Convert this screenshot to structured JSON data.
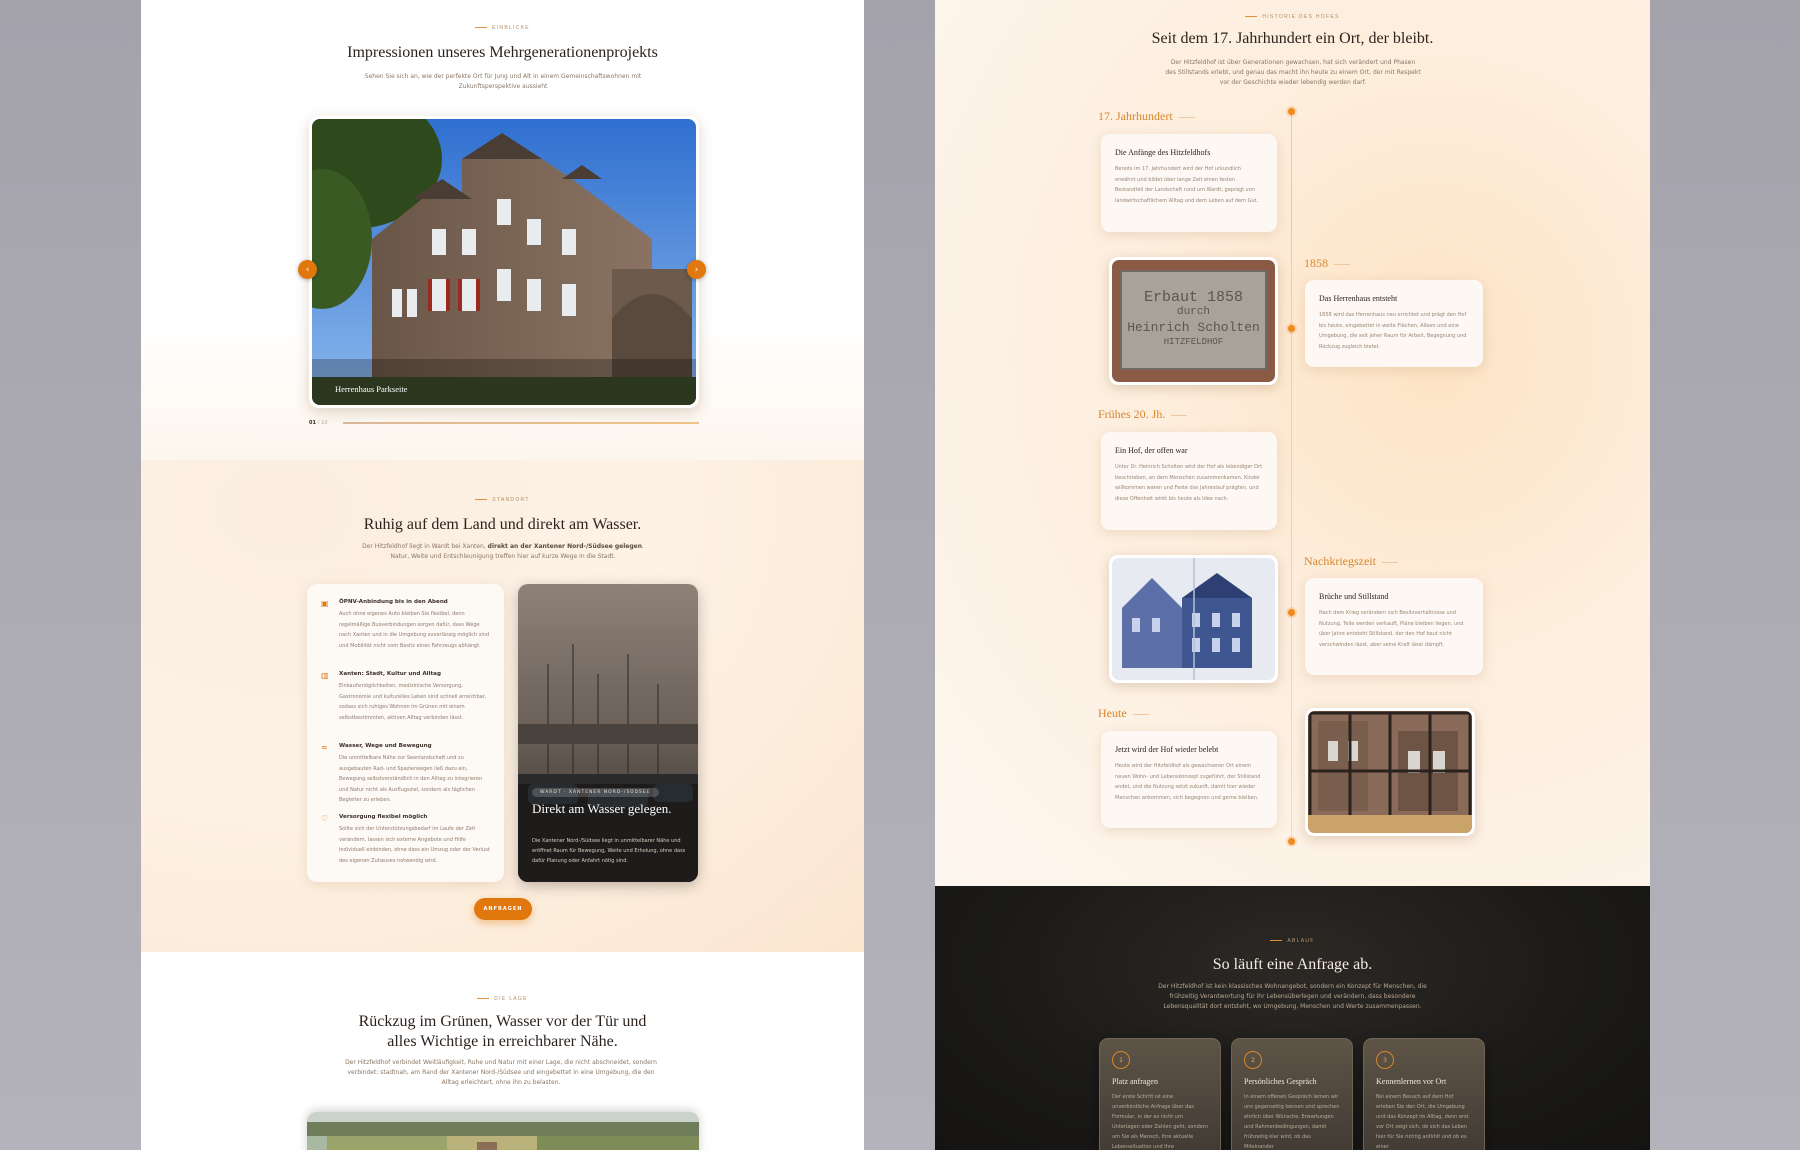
{
  "left": {
    "gallery": {
      "eyebrow": "EINBLICKE",
      "title": "Impressionen unseres Mehrgenerationenprojekts",
      "lead": "Sehen Sie sich an, wie der perfekte Ort für Jung und Alt in einem Gemeinschaftswohnen mit Zukunftsperspektive aussieht",
      "caption": "Herrenhaus Parkseite",
      "counter_current": "01",
      "counter_sep": "/",
      "counter_total": "10",
      "prev_icon": "‹",
      "next_icon": "›"
    },
    "location": {
      "eyebrow": "STANDORT",
      "title": "Ruhig auf dem Land und direkt am Wasser.",
      "lead_pre": "Der Hitzfeldhof liegt in Wardt bei Xanten, ",
      "lead_bold": "direkt an der Xantener Nord-/Südsee gelegen",
      "lead_post": ". Natur, Weite und Entschleunigung treffen hier auf kurze Wege in die Stadt.",
      "features": [
        {
          "icon": "bus-icon",
          "glyph": "▣",
          "title": "ÖPNV-Anbindung bis in den Abend",
          "text": "Auch ohne eigenes Auto bleiben Sie flexibel, denn regelmäßige Busverbindungen sorgen dafür, dass Wege nach Xanten und in die Umgebung zuverlässig möglich sind und Mobilität nicht vom Besitz eines Fahrzeugs abhängt."
        },
        {
          "icon": "city-icon",
          "glyph": "▥",
          "title": "Xanten: Stadt, Kultur und Alltag",
          "text": "Einkaufsmöglichkeiten, medizinische Versorgung, Gastronomie und kulturelles Leben sind schnell erreichbar, sodass sich ruhiges Wohnen im Grünen mit einem selbstbestimmten, aktiven Alltag verbinden lässt."
        },
        {
          "icon": "wave-icon",
          "glyph": "≈",
          "title": "Wasser, Wege und Bewegung",
          "text": "Die unmittelbare Nähe zur Seenlandschaft und zu ausgebauten Rad- und Spazierwegen ließ dazu ein, Bewegung selbstverständlich in den Alltag zu integrieren und Natur nicht als Ausflugsziel, sondern als täglichen Begleiter zu erleben."
        },
        {
          "icon": "heart-icon",
          "glyph": "♡",
          "title": "Versorgung flexibel möglich",
          "text": "Sollte sich der Unterstützungsbedarf im Laufe der Zeit verändern, lassen sich externe Angebote und Hilfe individuell einbinden, ohne dass ein Umzug oder der Verlust des eigenen Zuhauses notwendig wird."
        }
      ],
      "water_tag": "WARDT · XANTENER NORD-/SÜDSEE",
      "water_title": "Direkt am Wasser gelegen.",
      "water_text": "Die Xantener Nord-/Südsee liegt in unmittelbarer Nähe und eröffnet Raum für Bewegung, Weite und Erholung, ohne dass dafür Planung oder Anfahrt nötig sind.",
      "cta": "ANFRAGEN"
    },
    "lage": {
      "eyebrow": "DIE LAGE",
      "title_line1": "Rückzug im Grünen, Wasser vor der Tür und",
      "title_line2": "alles Wichtige in erreichbarer Nähe.",
      "lead": "Der Hitzfeldhof verbindet Weitläufigkeit, Ruhe und Natur mit einer Lage, die nicht abschneidet, sondern verbindet: stadtnah, am Rand der Xantener Nord-/Südsee und eingebettet in eine Umgebung, die den Alltag erleichtert, ohne ihn zu belasten."
    }
  },
  "right": {
    "history": {
      "eyebrow": "HISTORIE DES HOFES",
      "title": "Seit dem 17. Jahrhundert ein Ort, der bleibt.",
      "lead": "Der Hitzfeldhof ist über Generationen gewachsen, hat sich verändert und Phasen des Stillstands erlebt, und genau das macht ihn heute zu einem Ort, der mit Respekt vor der Geschichte wieder lebendig werden darf.",
      "entries": [
        {
          "era": "17. Jahrhundert",
          "title": "Die Anfänge des Hitzfeldhofs",
          "text": "Bereits im 17. Jahrhundert wird der Hof urkundlich erwähnt und bildet über lange Zeit einen festen Bestandteil der Landschaft rund um Wardt, geprägt von landwirtschaftlichem Alltag und dem Leben auf dem Gut."
        },
        {
          "era": "1858",
          "title": "Das Herrenhaus entsteht",
          "text": "1858 wird das Herrenhaus neu errichtet und prägt den Hof bis heute, eingebettet in weite Flächen, Alleen und eine Umgebung, die seit jeher Raum für Arbeit, Begegnung und Rückzug zugleich bietet.",
          "stone_line1": "Erbaut 1858",
          "stone_line2": "durch",
          "stone_line3": "Heinrich Scholten",
          "stone_line4": "HITZFELDHOF"
        },
        {
          "era": "Frühes 20. Jh.",
          "title": "Ein Hof, der offen war",
          "text": "Unter Dr. Heinrich Scholten wird der Hof als lebendiger Ort beschrieben, an dem Menschen zusammenkamen, Kinder willkommen waren und Feste das Jahreslauf prägten, und diese Offenheit wirkt bis heute als Idee nach."
        },
        {
          "era": "Nachkriegszeit",
          "title": "Brüche und Stillstand",
          "text": "Nach dem Krieg verändern sich Besitzverhältnisse und Nutzung. Teile werden verkauft, Pläne bleiben liegen, und über Jahre entsteht Stillstand, der den Hof baut nicht verschwinden lässt, aber seine Kraft lässt dämpft."
        },
        {
          "era": "Heute",
          "title": "Jetzt wird der Hof wieder belebt",
          "text": "Heute wird der Hitzfeldhof als gewachsener Ort einem neuen Wohn- und Lebenskonzept zugeführt, der Stillstand endet, und die Nutzung setzt zukunft, damit hier wieder Menschen ankommen, sich begegnen und gerne bleiben."
        }
      ]
    },
    "process": {
      "eyebrow": "ABLAUF",
      "title": "So läuft eine Anfrage ab.",
      "lead": "Der Hitzfeldhof ist kein klassisches Wohnangebot, sondern ein Konzept für Menschen, die frühzeitig Verantwortung für ihr Lebensüberlegen und verändern, dass besondere Lebensqualität dort entsteht, wo Umgebung, Menschen und Werte zusammenpassen.",
      "steps": [
        {
          "num": "1",
          "title": "Platz anfragen",
          "text": "Der erste Schritt ist eine unverbindliche Anfrage über das Formular, in der es nicht um Unterlagen oder Zahlen geht, sondern um Sie als Mensch, Ihre aktuelle Lebenssituation und Ihre"
        },
        {
          "num": "2",
          "title": "Persönliches Gespräch",
          "text": "In einem offenen Gespräch lernen wir uns gegenseitig kennen und sprechen ehrlich über Wünsche, Erwartungen und Rahmenbedingungen, damit frühzeitig klar wird, ob das Miteinander"
        },
        {
          "num": "3",
          "title": "Kennenlernen vor Ort",
          "text": "Bei einem Besuch auf dem Hof erleben Sie den Ort, die Umgebung und das Konzept im Alltag, denn erst vor Ort zeigt sich, ob sich das Leben hier für Sie richtig anfühlt und ob es einer"
        }
      ]
    }
  }
}
